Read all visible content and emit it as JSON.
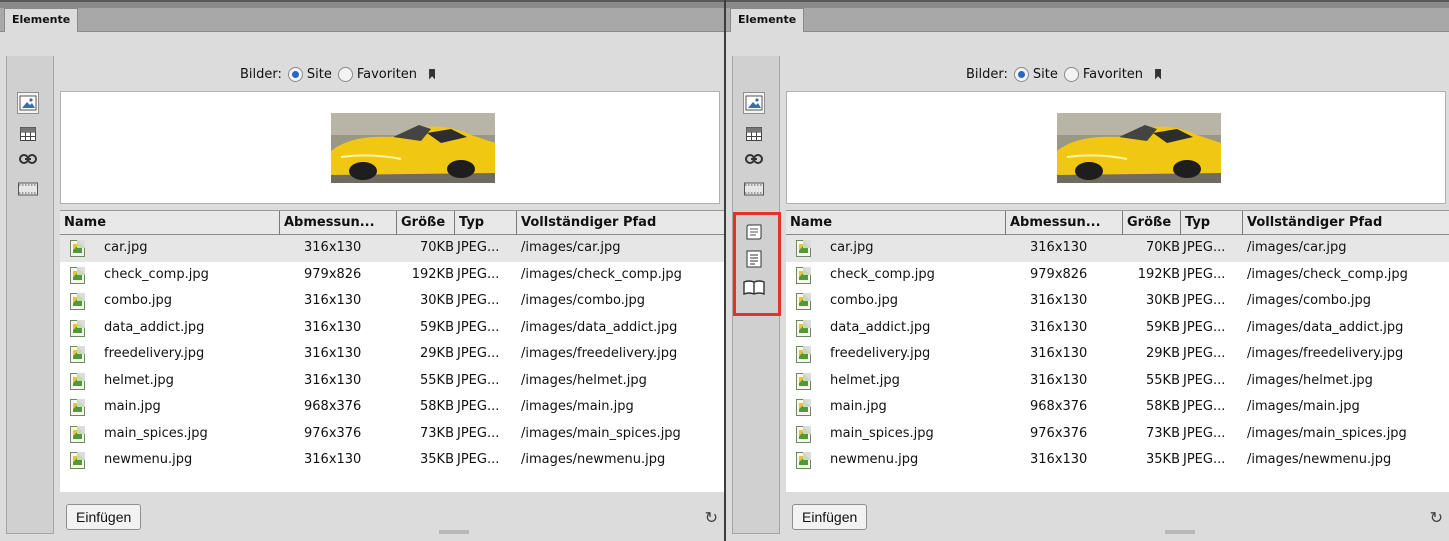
{
  "panels": [
    {
      "tab_label": "Elemente",
      "bilder_label": "Bilder:",
      "radio_site": "Site",
      "radio_favoriten": "Favoriten",
      "columns": [
        "Name",
        "Abmessun...",
        "Größe",
        "Typ",
        "Vollständiger Pfad"
      ],
      "insert_button": "Einfügen",
      "highlighted_icons": false
    },
    {
      "tab_label": "Elemente",
      "bilder_label": "Bilder:",
      "radio_site": "Site",
      "radio_favoriten": "Favoriten",
      "columns": [
        "Name",
        "Abmessun...",
        "Größe",
        "Typ",
        "Vollständiger Pfad"
      ],
      "insert_button": "Einfügen",
      "highlighted_icons": true
    }
  ],
  "files": [
    {
      "name": "car.jpg",
      "dim": "316x130",
      "size": "70KB",
      "type": "JPEG...",
      "path": "/images/car.jpg"
    },
    {
      "name": "check_comp.jpg",
      "dim": "979x826",
      "size": "192KB",
      "type": "JPEG...",
      "path": "/images/check_comp.jpg"
    },
    {
      "name": "combo.jpg",
      "dim": "316x130",
      "size": "30KB",
      "type": "JPEG...",
      "path": "/images/combo.jpg"
    },
    {
      "name": "data_addict.jpg",
      "dim": "316x130",
      "size": "59KB",
      "type": "JPEG...",
      "path": "/images/data_addict.jpg"
    },
    {
      "name": "freedelivery.jpg",
      "dim": "316x130",
      "size": "29KB",
      "type": "JPEG...",
      "path": "/images/freedelivery.jpg"
    },
    {
      "name": "helmet.jpg",
      "dim": "316x130",
      "size": "55KB",
      "type": "JPEG...",
      "path": "/images/helmet.jpg"
    },
    {
      "name": "main.jpg",
      "dim": "968x376",
      "size": "58KB",
      "type": "JPEG...",
      "path": "/images/main.jpg"
    },
    {
      "name": "main_spices.jpg",
      "dim": "976x376",
      "size": "73KB",
      "type": "JPEG...",
      "path": "/images/main_spices.jpg"
    },
    {
      "name": "newmenu.jpg",
      "dim": "316x130",
      "size": "35KB",
      "type": "JPEG...",
      "path": "/images/newmenu.jpg"
    }
  ],
  "selected_row": 0,
  "colors": {
    "highlight": "#e0322e",
    "radio": "#2a66c8"
  }
}
